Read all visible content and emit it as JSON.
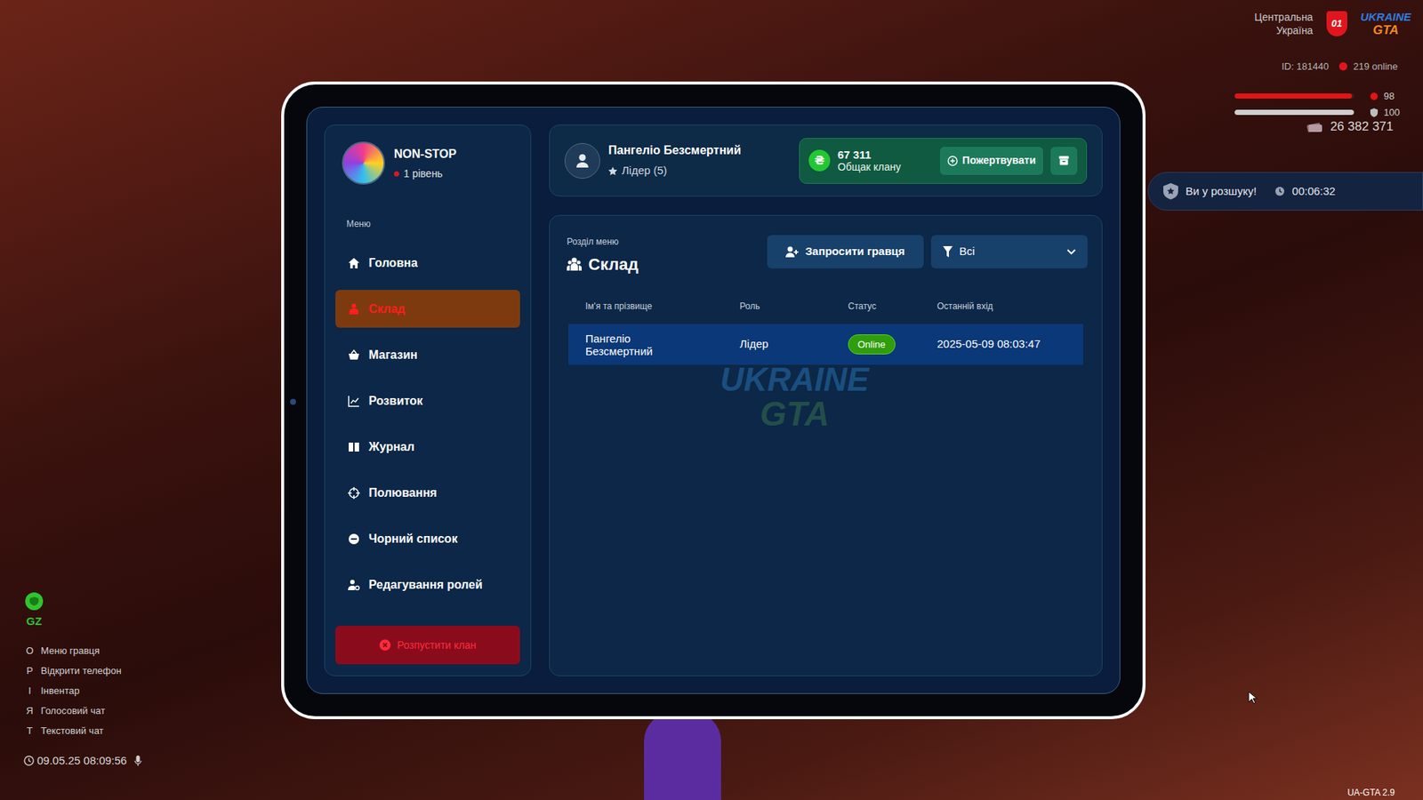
{
  "hud": {
    "region": [
      "Центральна",
      "Україна"
    ],
    "region_code": "01",
    "logo": [
      "UKRAINE",
      "GTA"
    ],
    "player_id": "ID: 181440",
    "online": "219 online",
    "health": {
      "value": "98",
      "level": 0.98
    },
    "armor": {
      "value": "100",
      "level": 1
    },
    "money": "26 382 371",
    "wanted": {
      "text": "Ви у розшуку!",
      "timer": "00:06:32"
    },
    "zone": "GZ",
    "hints": [
      {
        "key": "O",
        "label": "Меню гравця"
      },
      {
        "key": "P",
        "label": "Відкрити телефон"
      },
      {
        "key": "I",
        "label": "Інвентар"
      },
      {
        "key": "Я",
        "label": "Голосовий чат"
      },
      {
        "key": "T",
        "label": "Текстовий чат"
      }
    ],
    "datetime": "09.05.25 08:09:56",
    "version": "UA-GTA 2.9"
  },
  "clan": {
    "name": "NON-STOP",
    "level": "1 рівень"
  },
  "sidebar": {
    "heading": "Меню",
    "items": [
      {
        "label": "Головна",
        "selected": false
      },
      {
        "label": "Склад",
        "selected": true
      },
      {
        "label": "Магазин",
        "selected": false
      },
      {
        "label": "Розвиток",
        "selected": false
      },
      {
        "label": "Журнал",
        "selected": false
      },
      {
        "label": "Полювання",
        "selected": false
      },
      {
        "label": "Чорний список",
        "selected": false
      },
      {
        "label": "Редагування ролей",
        "selected": false
      }
    ],
    "disband": "Розпустити клан"
  },
  "header": {
    "player": "Пангеліо Безсмертний",
    "role": "Лідер (5)",
    "currency_icon": "₴",
    "balance": "67 311",
    "balance_label": "Общак клану",
    "donate": "Пожертвувати"
  },
  "section": {
    "caption": "Розділ меню",
    "title": "Склад",
    "invite": "Запросити гравця",
    "filter": "Всі"
  },
  "table": {
    "columns": [
      "Ім'я та прізвище",
      "Роль",
      "Статус",
      "Останній вхід"
    ],
    "rows": [
      {
        "cells": [
          "Пангеліо Безсмертний",
          "Лідер",
          "Online",
          "2025-05-09 08:03:47"
        ],
        "selected": true,
        "online": true
      }
    ]
  },
  "watermark": [
    "UKRAINE",
    "GTA"
  ]
}
